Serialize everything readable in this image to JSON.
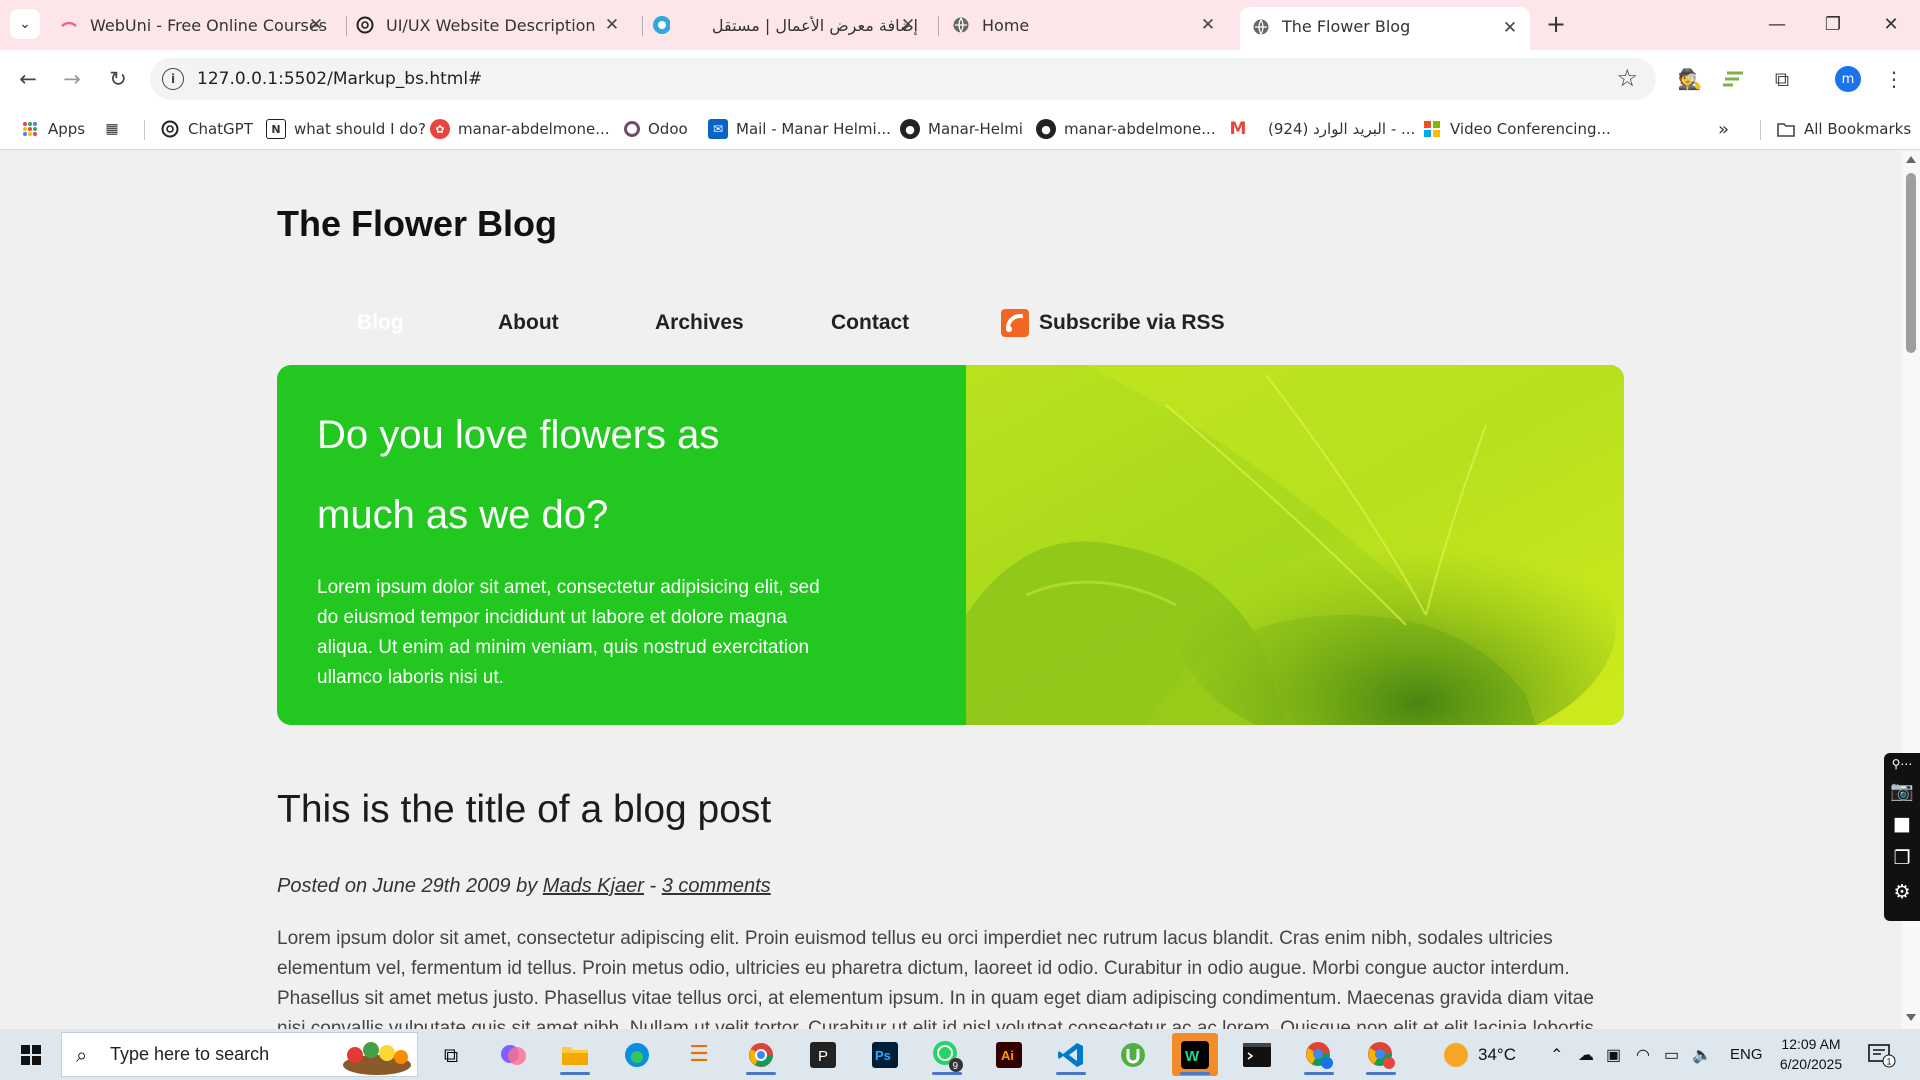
{
  "browser": {
    "tabs": [
      {
        "title": "WebUni - Free Online Courses",
        "icon": "webuni-icon"
      },
      {
        "title": "UI/UX Website Description",
        "icon": "chatgpt-icon"
      },
      {
        "title": "إضافة معرض الأعمال | مستقل",
        "icon": "mostaql-icon"
      },
      {
        "title": "Home",
        "icon": "globe-icon"
      },
      {
        "title": "The Flower Blog",
        "icon": "globe-icon",
        "active": true
      }
    ],
    "url": "127.0.0.1:5502/Markup_bs.html#",
    "profile_initial": "m",
    "bookmarks": [
      {
        "label": "Apps"
      },
      {
        "label": "ChatGPT"
      },
      {
        "label": "what should I do?"
      },
      {
        "label": "manar-abdelmone..."
      },
      {
        "label": "Odoo"
      },
      {
        "label": "Mail - Manar Helmi..."
      },
      {
        "label": "Manar-Helmi"
      },
      {
        "label": "manar-abdelmone..."
      },
      {
        "label": "(924) البريد الوارد - ..."
      },
      {
        "label": "Video Conferencing..."
      }
    ],
    "all_bookmarks": "All Bookmarks"
  },
  "page": {
    "site_title": "The Flower Blog",
    "nav": [
      "Blog",
      "About",
      "Archives",
      "Contact",
      "Subscribe via RSS"
    ],
    "hero": {
      "title": "Do you love flowers as much as we do?",
      "body": "Lorem ipsum dolor sit amet, consectetur adipisicing elit, sed do eiusmod tempor incididunt ut labore et dolore magna aliqua. Ut enim ad minim veniam, quis nostrud exercitation ullamco laboris nisi ut."
    },
    "post": {
      "title": "This is the title of a blog post",
      "meta_prefix": "Posted on June 29th 2009 by",
      "author": "Mads Kjaer",
      "meta_sep": "-",
      "comments": "3 comments",
      "body": "Lorem ipsum dolor sit amet, consectetur adipiscing elit. Proin euismod tellus eu orci imperdiet nec rutrum lacus blandit. Cras enim nibh, sodales ultricies elementum vel, fermentum id tellus. Proin metus odio, ultricies eu pharetra dictum, laoreet id odio. Curabitur in odio augue. Morbi congue auctor interdum. Phasellus sit amet metus justo. Phasellus vitae tellus orci, at elementum ipsum. In in quam eget diam adipiscing condimentum. Maecenas gravida diam vitae nisi convallis vulputate quis sit amet nibh. Nullam ut velit tortor. Curabitur ut elit id nisl volutpat consectetur ac ac lorem. Quisque non elit et elit lacinia lobortis nec a"
    }
  },
  "taskbar": {
    "search_placeholder": "Type here to search",
    "weather": "34°C",
    "language": "ENG",
    "time": "12:09 AM",
    "date": "6/20/2025",
    "whatsapp_badge": "9",
    "notification_badge": "1"
  },
  "colors": {
    "hero_green": "#22c81f",
    "tab_strip": "#fde6ea",
    "rss_orange": "#f26522"
  }
}
